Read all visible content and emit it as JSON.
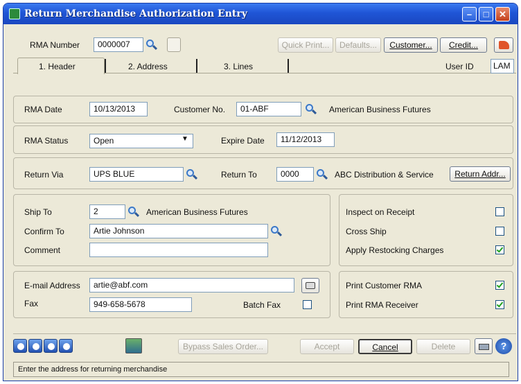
{
  "window": {
    "title": "Return Merchandise Authorization Entry",
    "minimize_icon": "minimize-icon",
    "maximize_icon": "maximize-icon",
    "close_icon": "close-icon"
  },
  "toolbar": {
    "rma_number_label": "RMA Number",
    "rma_number_value": "0000007",
    "quick_print": "Quick Print...",
    "defaults": "Defaults...",
    "customer": "Customer...",
    "credit": "Credit..."
  },
  "tabs": [
    {
      "label": "1. Header"
    },
    {
      "label": "2. Address"
    },
    {
      "label": "3. Lines"
    }
  ],
  "user": {
    "label": "User ID",
    "value": "LAM"
  },
  "header": {
    "rma_date_label": "RMA Date",
    "rma_date_value": "10/13/2013",
    "customer_no_label": "Customer No.",
    "customer_no_value": "01-ABF",
    "customer_name": "American Business Futures",
    "rma_status_label": "RMA Status",
    "rma_status_value": "Open",
    "expire_date_label": "Expire Date",
    "expire_date_value": "11/12/2013",
    "return_via_label": "Return Via",
    "return_via_value": "UPS BLUE",
    "return_to_label": "Return To",
    "return_to_value": "0000",
    "return_to_name": "ABC Distribution & Service",
    "return_addr_button": "Return Addr..."
  },
  "ship": {
    "ship_to_label": "Ship To",
    "ship_to_value": "2",
    "ship_to_name": "American Business Futures",
    "confirm_to_label": "Confirm To",
    "confirm_to_value": "Artie Johnson",
    "comment_label": "Comment",
    "comment_value": ""
  },
  "options": {
    "inspect_label": "Inspect on Receipt",
    "inspect_checked": false,
    "cross_ship_label": "Cross Ship",
    "cross_ship_checked": false,
    "restocking_label": "Apply Restocking Charges",
    "restocking_checked": true
  },
  "contact": {
    "email_label": "E-mail Address",
    "email_value": "artie@abf.com",
    "fax_label": "Fax",
    "fax_value": "949-658-5678",
    "batch_fax_label": "Batch Fax",
    "batch_fax_checked": false
  },
  "print": {
    "customer_rma_label": "Print Customer RMA",
    "customer_rma_checked": true,
    "receiver_label": "Print RMA Receiver",
    "receiver_checked": true
  },
  "bottom": {
    "bypass_sales_order": "Bypass Sales Order...",
    "accept": "Accept",
    "cancel": "Cancel",
    "delete": "Delete"
  },
  "status_text": "Enter the address for returning merchandise",
  "colors": {
    "title_bar": "#1f55d6",
    "window_bg": "#ece9d8",
    "check_green": "#21a121"
  }
}
